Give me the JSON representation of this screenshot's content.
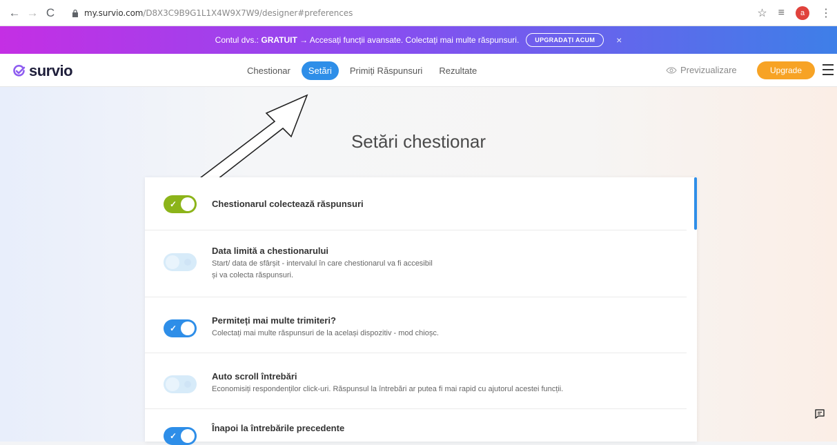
{
  "browser": {
    "url_host": "my.survio.com",
    "url_path": "/D8X3C9B9G1L1X4W9X7W9/designer#preferences",
    "profile_initial": "a"
  },
  "promo": {
    "prefix": "Contul dvs.: ",
    "plan": "GRATUIT",
    "message": " → Accesați funcții avansate. Colectați mai multe răspunsuri.",
    "button": "UPGRADAȚI ACUM",
    "close": "×"
  },
  "header": {
    "logo": "survio",
    "tabs": [
      {
        "label": "Chestionar"
      },
      {
        "label": "Setări"
      },
      {
        "label": "Primiți Răspunsuri"
      },
      {
        "label": "Rezultate"
      }
    ],
    "active_tab": "Setări",
    "preview": "Previzualizare",
    "upgrade": "Upgrade"
  },
  "main": {
    "title": "Setări chestionar",
    "settings": [
      {
        "title": "Chestionarul colectează răspunsuri",
        "desc": "",
        "state": "on",
        "color": "#8cb41a"
      },
      {
        "title": "Data limită a chestionarului",
        "desc": "Start/ data de sfârșit - intervalul în care chestionarul va fi accesibil și va colecta răspunsuri.",
        "state": "off",
        "color": "#d7ebf9"
      },
      {
        "title": "Permiteți mai multe trimiteri?",
        "desc": "Colectați mai multe răspunsuri de la același dispozitiv - mod chioșc.",
        "state": "on",
        "color": "#2e8ee8"
      },
      {
        "title": "Auto scroll întrebări",
        "desc": "Economisiți respondenților click-uri. Răspunsul la întrebări ar putea fi mai rapid cu ajutorul acestei funcții.",
        "state": "off",
        "color": "#d7ebf9"
      },
      {
        "title": "Înapoi la întrebările precedente",
        "desc": "",
        "state": "on",
        "color": "#2e8ee8"
      }
    ]
  },
  "colors": {
    "accent": "#2e8ee8",
    "upgrade": "#f7a325",
    "toggle_green": "#8cb41a"
  },
  "icons": {
    "back": "back-arrow-icon",
    "forward": "forward-arrow-icon",
    "reload": "reload-icon",
    "lock": "lock-icon",
    "star": "star-icon",
    "preview": "eye-icon",
    "menu": "hamburger-icon",
    "feedback": "chat-icon"
  }
}
